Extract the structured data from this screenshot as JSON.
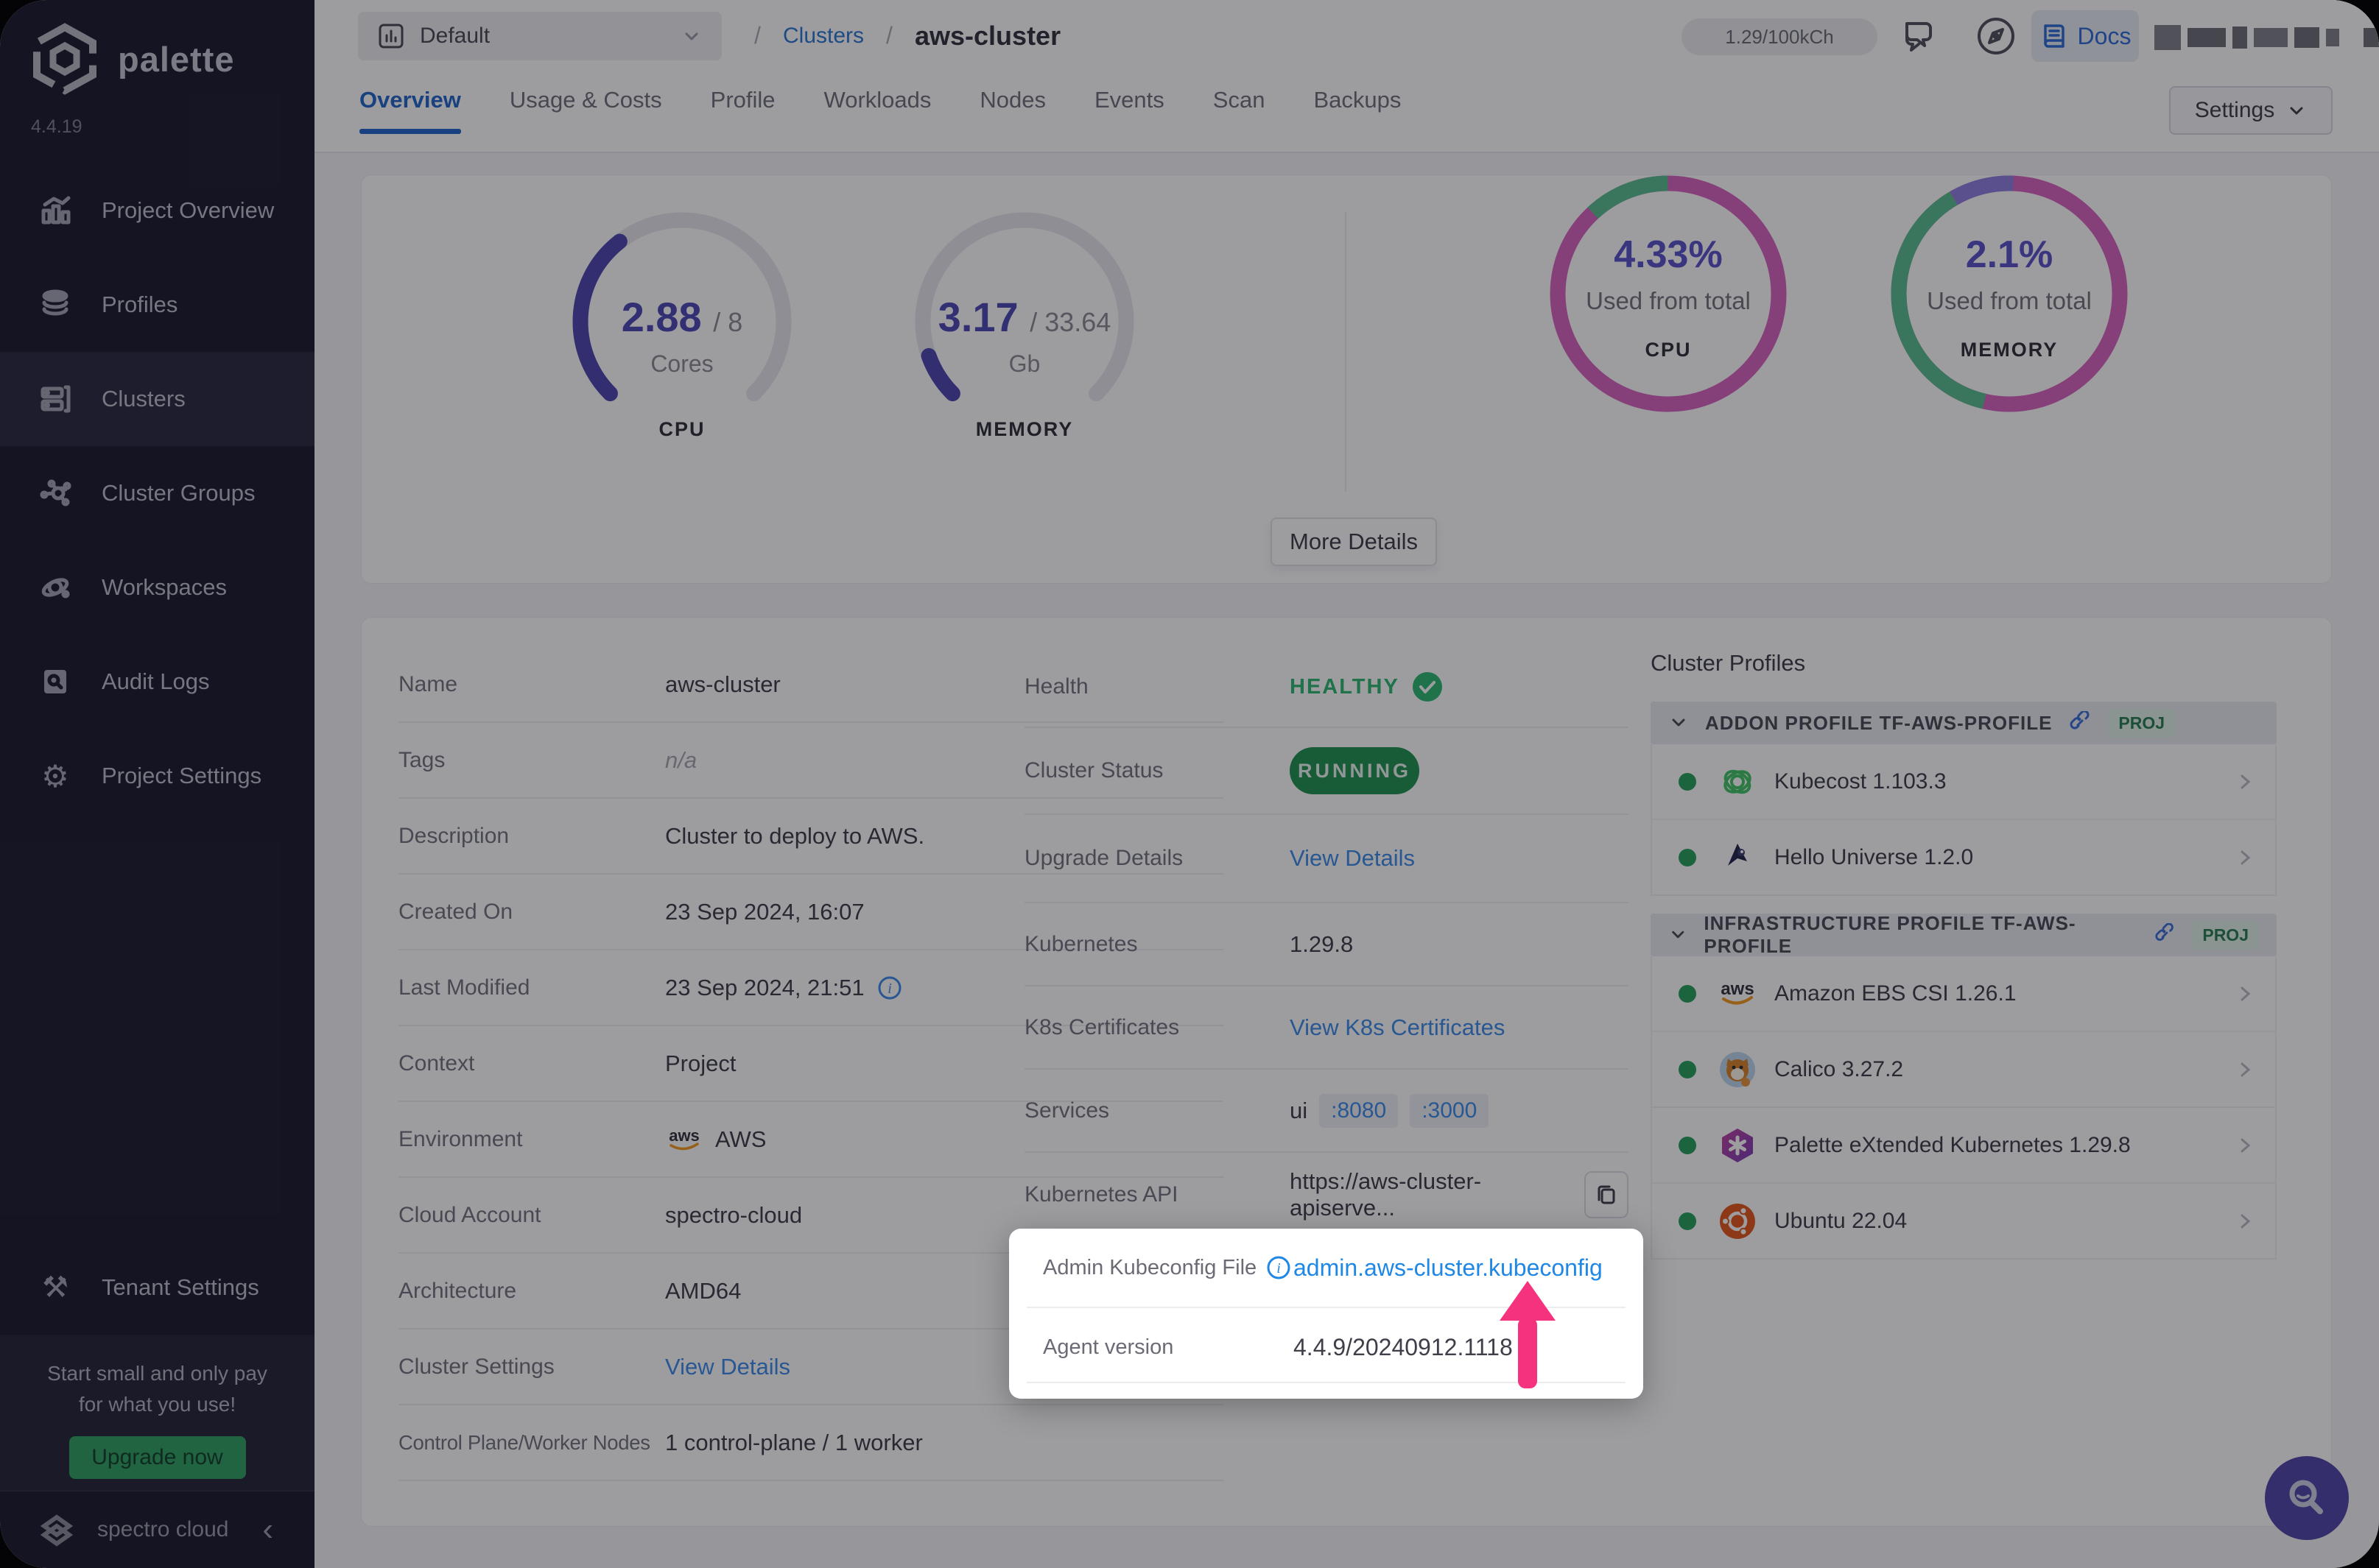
{
  "brand": {
    "name": "palette",
    "version": "4.4.19",
    "footer": "spectro cloud"
  },
  "sidebar": {
    "items": [
      {
        "label": "Project Overview"
      },
      {
        "label": "Profiles"
      },
      {
        "label": "Clusters"
      },
      {
        "label": "Cluster Groups"
      },
      {
        "label": "Workspaces"
      },
      {
        "label": "Audit Logs"
      },
      {
        "label": "Project Settings"
      }
    ],
    "tenant_settings": "Tenant Settings",
    "upgrade": {
      "line1": "Start small and only pay",
      "line2": "for what you use!",
      "button": "Upgrade now"
    }
  },
  "topbar": {
    "project_selector": "Default",
    "separator": "/",
    "breadcrumb_section": "Clusters",
    "breadcrumb_current": "aws-cluster",
    "usage_badge": "1.29/100kCh",
    "docs": "Docs"
  },
  "tabs": {
    "items": [
      "Overview",
      "Usage & Costs",
      "Profile",
      "Workloads",
      "Nodes",
      "Events",
      "Scan",
      "Backups"
    ],
    "settings_button": "Settings"
  },
  "gauges": {
    "cpu": {
      "used": "2.88",
      "total": "/ 8",
      "unit": "Cores",
      "label": "CPU",
      "fraction": 0.36
    },
    "memory": {
      "used": "3.17",
      "total": "/ 33.64",
      "unit": "Gb",
      "label": "MEMORY",
      "fraction": 0.094
    }
  },
  "usage_rings": {
    "cpu": {
      "percent": "4.33%",
      "caption": "Used from total",
      "label": "CPU"
    },
    "memory": {
      "percent": "2.1%",
      "caption": "Used from total",
      "label": "MEMORY"
    }
  },
  "more_details": "More Details",
  "overview": {
    "name_label": "Name",
    "name_value": "aws-cluster",
    "tags_label": "Tags",
    "tags_value": "n/a",
    "description_label": "Description",
    "description_value": "Cluster to deploy to AWS.",
    "created_label": "Created On",
    "created_value": "23 Sep 2024, 16:07",
    "modified_label": "Last Modified",
    "modified_value": "23 Sep 2024, 21:51",
    "context_label": "Context",
    "context_value": "Project",
    "environment_label": "Environment",
    "environment_value": "AWS",
    "cloud_account_label": "Cloud Account",
    "cloud_account_value": "spectro-cloud",
    "architecture_label": "Architecture",
    "architecture_value": "AMD64",
    "cluster_settings_label": "Cluster Settings",
    "cluster_settings_value": "View Details",
    "nodes_label": "Control Plane/Worker Nodes",
    "nodes_value": "1 control-plane / 1 worker"
  },
  "status": {
    "health_label": "Health",
    "health_value": "HEALTHY",
    "cluster_status_label": "Cluster Status",
    "cluster_status_value": "RUNNING",
    "upgrade_label": "Upgrade Details",
    "upgrade_value": "View Details",
    "kubernetes_label": "Kubernetes",
    "kubernetes_value": "1.29.8",
    "certs_label": "K8s Certificates",
    "certs_value": "View K8s Certificates",
    "services_label": "Services",
    "services_name": "ui",
    "services_port1": ":8080",
    "services_port2": ":3000",
    "api_label": "Kubernetes API",
    "api_value": "https://aws-cluster-apiserve..."
  },
  "spotlight": {
    "kubeconfig_label": "Admin Kubeconfig File",
    "kubeconfig_value": "admin.aws-cluster.kubeconfig",
    "agent_label": "Agent version",
    "agent_value": "4.4.9/20240912.1118"
  },
  "cluster_profiles": {
    "title": "Cluster Profiles",
    "sections": [
      {
        "header": "ADDON PROFILE TF-AWS-PROFILE",
        "badge": "PROJ",
        "items": [
          {
            "name": "Kubecost 1.103.3"
          },
          {
            "name": "Hello Universe 1.2.0"
          }
        ]
      },
      {
        "header": "INFRASTRUCTURE PROFILE TF-AWS-PROFILE",
        "badge": "PROJ",
        "items": [
          {
            "name": "Amazon EBS CSI 1.26.1"
          },
          {
            "name": "Calico 3.27.2"
          },
          {
            "name": "Palette eXtended Kubernetes 1.29.8"
          },
          {
            "name": "Ubuntu 22.04"
          }
        ]
      }
    ]
  },
  "colors": {
    "accent_blue": "#1f87e5",
    "magenta": "#d964be",
    "ring_green": "#5bbd8f",
    "violet": "#8f7fe0",
    "gauge_indigo": "#4d46b0",
    "healthy_green": "#2eb871",
    "running_green": "#219150",
    "arrow_pink": "#f5327e",
    "upgrade_green": "#2fa061"
  }
}
